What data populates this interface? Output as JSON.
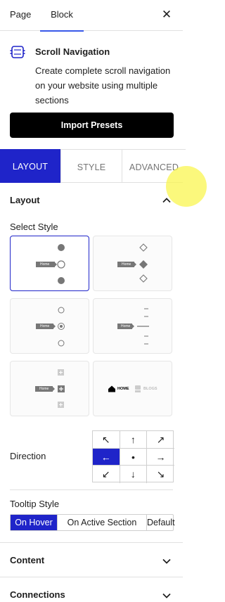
{
  "header": {
    "tab_page": "Page",
    "tab_block": "Block",
    "close_glyph": "✕"
  },
  "block": {
    "icon": "scroll-navigation-icon",
    "title": "Scroll Navigation",
    "description": "Create complete scroll navigation on your website using multiple sections"
  },
  "import_button": "Import Presets",
  "style_tabs": [
    "LAYOUT",
    "STYLE",
    "ADVANCED"
  ],
  "active_style_tab": "LAYOUT",
  "layout_panel": {
    "title": "Layout",
    "select_style_label": "Select Style",
    "style_cards": [
      {
        "name": "dots-filled",
        "selected": true,
        "tooltip": "Home"
      },
      {
        "name": "diamonds",
        "selected": false,
        "tooltip": "Home"
      },
      {
        "name": "rings",
        "selected": false,
        "tooltip": "Home"
      },
      {
        "name": "lines",
        "selected": false,
        "tooltip": "Home"
      },
      {
        "name": "squares-plus",
        "selected": false,
        "tooltip": "Home"
      },
      {
        "name": "icons-text",
        "selected": false,
        "item_home": "HOME",
        "item_blogs": "BLOGS"
      }
    ],
    "direction_label": "Direction",
    "direction_arrows": [
      "↖",
      "↑",
      "↗",
      "←",
      "•",
      "→",
      "↙",
      "↓",
      "↘"
    ],
    "direction_selected": "←",
    "tooltip_style_label": "Tooltip Style",
    "tooltip_options": [
      "On Hover",
      "On Active Section",
      "Default"
    ],
    "tooltip_selected": "On Hover"
  },
  "collapsed_sections": [
    "Content",
    "Connections"
  ],
  "colors": {
    "accent": "#1f24c9",
    "tab_underline": "#3858e9",
    "button_bg": "#000000"
  }
}
